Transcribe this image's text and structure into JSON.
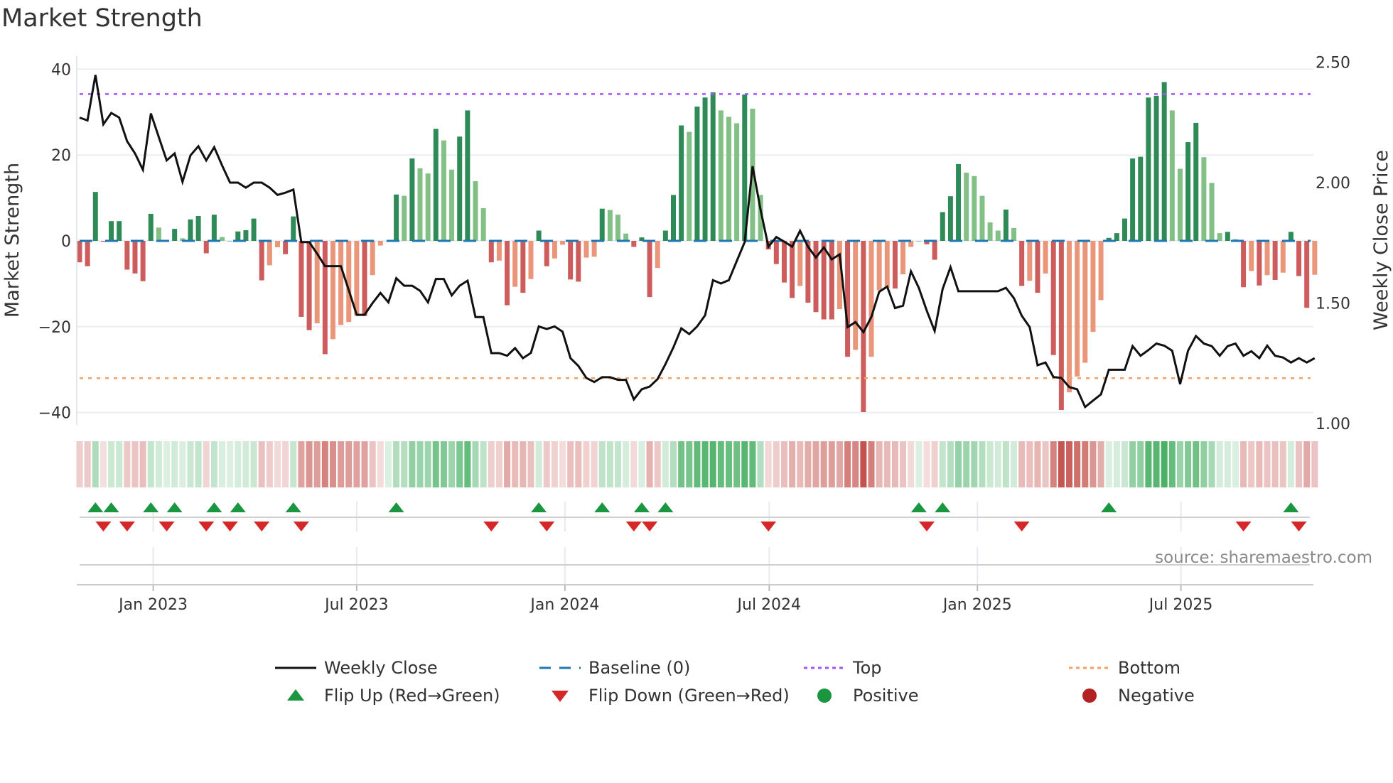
{
  "chart_data": {
    "type": "bar",
    "title": "Market Strength",
    "ylabel": "Market Strength",
    "y2label": "Weekly Close Price",
    "ylim": [
      -42,
      42
    ],
    "y2lim": [
      1.0,
      2.5
    ],
    "y_ticks": [
      40,
      20,
      0,
      -20,
      -40
    ],
    "y_tick_labels": [
      "40",
      "20",
      "0",
      "−20",
      "−40"
    ],
    "y2_ticks": [
      2.5,
      2.0,
      1.5,
      1.0
    ],
    "y2_tick_labels": [
      "2.50",
      "2.00",
      "1.50",
      "1.00"
    ],
    "x_unit": "week index (weekly bars, ~Nov 2022 to Nov 2025)",
    "x_ticks": [
      {
        "label": "Jan 2023",
        "week": 9.3
      },
      {
        "label": "Jul 2023",
        "week": 35.0
      },
      {
        "label": "Jan 2024",
        "week": 61.3
      },
      {
        "label": "Jul 2024",
        "week": 87.1
      },
      {
        "label": "Jan 2025",
        "week": 113.4
      },
      {
        "label": "Jul 2025",
        "week": 139.1
      }
    ],
    "top_level": 34.2,
    "bottom_level": -32.0,
    "baseline": 0,
    "strength": [
      -5,
      -5.9,
      11.4,
      -0.2,
      4.6,
      4.6,
      -6.7,
      -7.6,
      -9.4,
      6.3,
      3.1,
      0,
      2.8,
      0.6,
      5.0,
      5.8,
      -2.9,
      6.1,
      0.9,
      0,
      2.2,
      2.5,
      5.2,
      -9.2,
      -5.7,
      -1.5,
      -3.1,
      5.7,
      -17.7,
      -20.8,
      -19.2,
      -26.4,
      -22.9,
      -19.6,
      -18.9,
      -17.4,
      -17.5,
      -8,
      -1.1,
      0,
      10.8,
      10.5,
      19.2,
      16.9,
      15.7,
      26.1,
      23.4,
      16.6,
      24.3,
      30.4,
      13.9,
      7.6,
      -5,
      -4.6,
      -15,
      -10.7,
      -12.1,
      -8.9,
      2.4,
      -5.9,
      -4.1,
      -0.9,
      -9,
      -9.5,
      -3.9,
      -3.7,
      7.5,
      7.2,
      6.1,
      1.7,
      -1.4,
      0.8,
      -13.1,
      -6.3,
      2.4,
      10.7,
      26.9,
      25.4,
      31.3,
      33.4,
      34.6,
      30.4,
      28.9,
      27.4,
      34.1,
      30.8,
      10.7,
      -2,
      -5.4,
      -9.7,
      -13.3,
      -10.5,
      -14.4,
      -16.6,
      -18.3,
      -18.3,
      -15.9,
      -27,
      -25.4,
      -39.9,
      -27,
      -11.5,
      -10.9,
      -11.1,
      -7.8,
      -1.4,
      0,
      -0.8,
      -4.4,
      6.7,
      10.4,
      17.9,
      15.9,
      15.1,
      10.5,
      4.3,
      2.4,
      7.3,
      3.0,
      -10.5,
      -9.3,
      -12.1,
      -7.6,
      -26.6,
      -39.4,
      -35.3,
      -31.6,
      -28.4,
      -21.2,
      -13.8,
      0.7,
      1.8,
      5.2,
      19.2,
      19.6,
      33.4,
      33.8,
      37,
      30.4,
      16.8,
      23,
      27.5,
      19.5,
      13.5,
      1.8,
      2.1,
      0.4,
      -10.8,
      -7,
      -10.4,
      -8,
      -9.1,
      -7.4,
      2.1,
      -8.2,
      -15.6,
      -7.9
    ],
    "weekly_close": [
      2.27,
      2.258,
      2.447,
      2.242,
      2.289,
      2.27,
      2.172,
      2.121,
      2.053,
      2.287,
      2.189,
      2.092,
      2.121,
      2.003,
      2.113,
      2.151,
      2.092,
      2.147,
      2.071,
      2.0,
      2.0,
      1.979,
      2.0,
      2.0,
      1.979,
      1.949,
      1.958,
      1.971,
      1.753,
      1.753,
      1.705,
      1.653,
      1.653,
      1.653,
      1.553,
      1.451,
      1.451,
      1.5,
      1.542,
      1.503,
      1.603,
      1.572,
      1.572,
      1.551,
      1.503,
      1.6,
      1.6,
      1.532,
      1.572,
      1.593,
      1.442,
      1.442,
      1.292,
      1.292,
      1.281,
      1.313,
      1.271,
      1.293,
      1.403,
      1.392,
      1.403,
      1.381,
      1.271,
      1.239,
      1.189,
      1.172,
      1.192,
      1.192,
      1.181,
      1.181,
      1.1,
      1.142,
      1.153,
      1.184,
      1.247,
      1.316,
      1.395,
      1.371,
      1.403,
      1.449,
      1.595,
      1.581,
      1.595,
      1.674,
      1.753,
      2.068,
      1.889,
      1.734,
      1.774,
      1.755,
      1.734,
      1.8,
      1.734,
      1.689,
      1.731,
      1.681,
      1.702,
      1.4,
      1.421,
      1.379,
      1.442,
      1.547,
      1.568,
      1.479,
      1.489,
      1.632,
      1.563,
      1.468,
      1.384,
      1.558,
      1.649,
      1.549,
      1.549,
      1.549,
      1.549,
      1.549,
      1.549,
      1.563,
      1.521,
      1.447,
      1.4,
      1.242,
      1.253,
      1.193,
      1.189,
      1.151,
      1.142,
      1.068,
      1.095,
      1.121,
      1.223,
      1.223,
      1.223,
      1.321,
      1.281,
      1.305,
      1.332,
      1.323,
      1.302,
      1.163,
      1.302,
      1.363,
      1.332,
      1.321,
      1.281,
      1.321,
      1.332,
      1.281,
      1.3,
      1.271,
      1.323,
      1.281,
      1.274,
      1.253,
      1.271,
      1.253,
      1.271
    ],
    "flip_up_weeks": [
      2,
      4,
      9,
      12,
      17,
      20,
      27,
      40,
      58,
      66,
      71,
      74,
      106,
      109,
      130,
      153
    ],
    "flip_down_weeks": [
      3,
      6,
      11,
      16,
      19,
      23,
      28,
      52,
      59,
      70,
      72,
      87,
      107,
      119,
      147,
      154
    ],
    "legend": [
      {
        "label": "Weekly Close",
        "marker": "line",
        "color": "#111111"
      },
      {
        "label": "Baseline (0)",
        "marker": "dashed",
        "color": "#1f77b4"
      },
      {
        "label": "Top",
        "marker": "dotted",
        "color": "#a855f7"
      },
      {
        "label": "Bottom",
        "marker": "dotted",
        "color": "#f4a261"
      },
      {
        "label": "Flip Up (Red→Green)",
        "marker": "triangle-up",
        "color": "#1a9641"
      },
      {
        "label": "Flip Down (Green→Red)",
        "marker": "triangle-down",
        "color": "#d62728"
      },
      {
        "label": "Positive",
        "marker": "circle",
        "color": "#1a9641"
      },
      {
        "label": "Negative",
        "marker": "circle",
        "color": "#b22222"
      }
    ],
    "legend_position": "bottom",
    "source": "source: sharemaestro.com",
    "colors": {
      "pos_strong": "#2e8b57",
      "pos_weak": "#82c085",
      "neg_strong": "#cd5c5c",
      "neg_weak": "#e9967a",
      "grid": "#eceef4",
      "axis": "#cccccc"
    }
  }
}
